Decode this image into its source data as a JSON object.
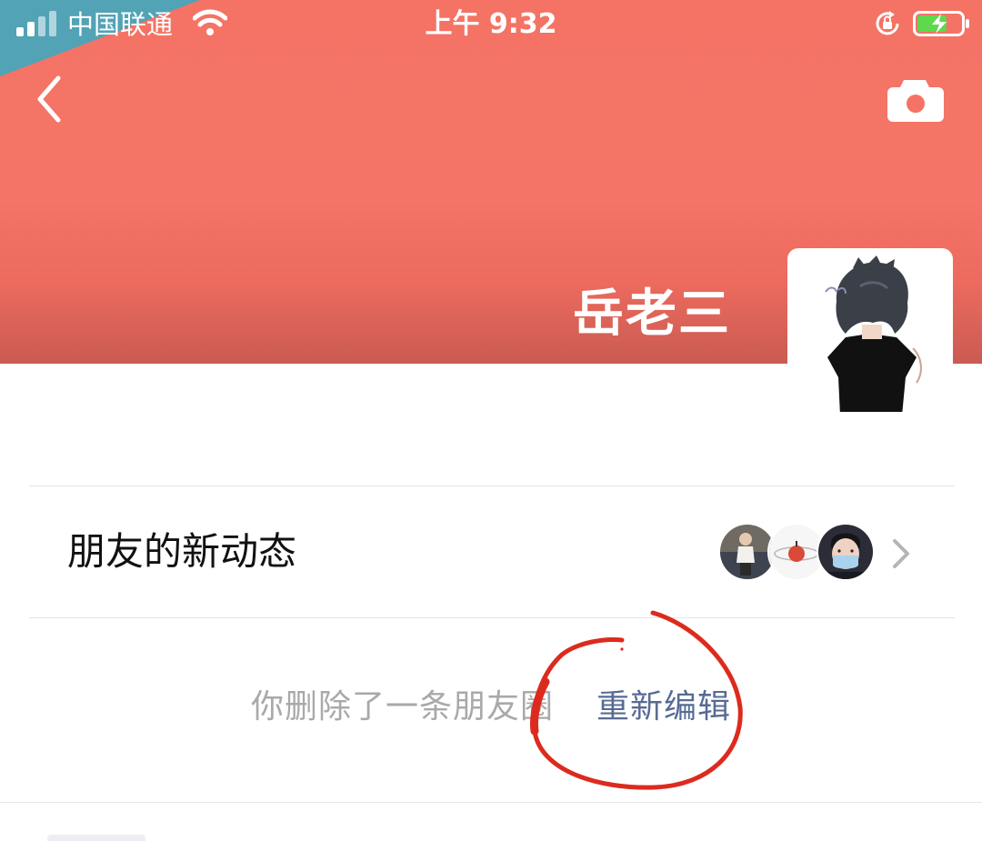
{
  "status_bar": {
    "carrier": "中国联通",
    "time": "上午 9:32",
    "icons": [
      "signal-icon",
      "wifi-icon",
      "rotation-lock-icon",
      "battery-charging-icon"
    ]
  },
  "header": {
    "back_icon": "back-chevron-icon",
    "camera_icon": "camera-icon",
    "user_name": "岳老三"
  },
  "friends_updates": {
    "label": "朋友的新动态",
    "avatars": [
      "friend-avatar-1",
      "friend-avatar-2",
      "friend-avatar-3"
    ],
    "chevron_icon": "chevron-right-icon"
  },
  "notice": {
    "deleted_text": "你删除了一条朋友圈",
    "re_edit_label": "重新编辑"
  },
  "colors": {
    "cover": "#f47365",
    "link": "#576b95",
    "muted_text": "#a9a9a9",
    "annotation": "#dc2b1e"
  }
}
